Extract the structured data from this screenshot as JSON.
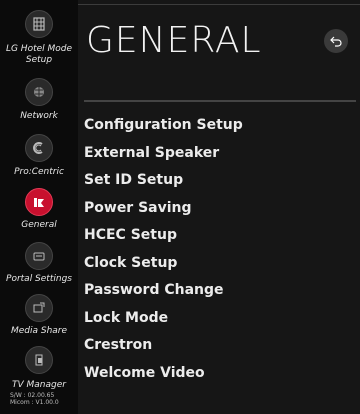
{
  "sidebar": {
    "items": [
      {
        "label": "LG Hotel Mode Setup",
        "icon": "hotel-mode-icon",
        "active": false
      },
      {
        "label": "Network",
        "icon": "network-icon",
        "active": false
      },
      {
        "label": "Pro:Centric",
        "icon": "procentric-icon",
        "active": false
      },
      {
        "label": "General",
        "icon": "general-icon",
        "active": true
      },
      {
        "label": "Portal Settings",
        "icon": "portal-settings-icon",
        "active": false
      },
      {
        "label": "Media Share",
        "icon": "media-share-icon",
        "active": false
      },
      {
        "label": "TV Manager",
        "icon": "tv-manager-icon",
        "active": false
      }
    ],
    "version_sw": "S/W : 02.00.65",
    "version_micom": "Micom : V1.00.0"
  },
  "main": {
    "title": "GENERAL",
    "back_icon": "back-arrow-icon",
    "menu": [
      "Configuration Setup",
      "External Speaker",
      "Set ID Setup",
      "Power Saving",
      "HCEC Setup",
      "Clock Setup",
      "Password Change",
      "Lock Mode",
      "Crestron",
      "Welcome Video"
    ]
  },
  "colors": {
    "accent": "#c8102e",
    "background": "#161616",
    "sidebar": "#0b0b0b",
    "text": "#ececec"
  }
}
